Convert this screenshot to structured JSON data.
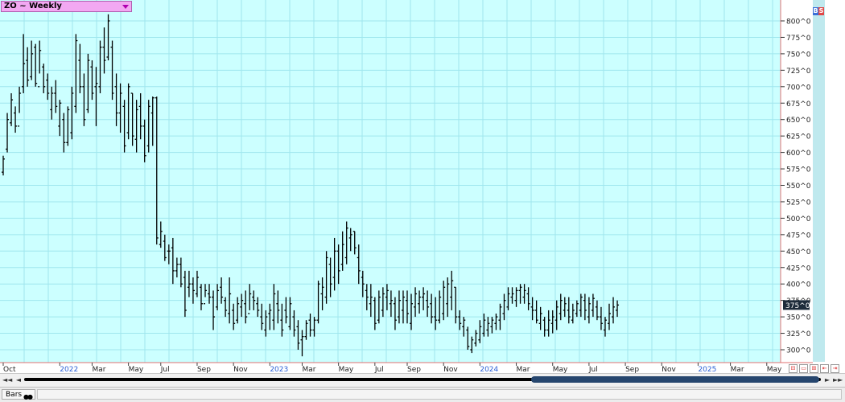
{
  "symbol_label": "ZO ~ Weekly",
  "signals": {
    "buy": "B",
    "sell": "S"
  },
  "bottom_tab_label": "Bars",
  "last_price_label": "375^0",
  "colors": {
    "plot_bg": "#ccffff",
    "grid": "#9fe6ee",
    "axis_line": "#e07070",
    "bars": "#000000",
    "year_label": "#2a5fd6",
    "price_badge_bg": "#1d2b3a"
  },
  "chart_data": {
    "type": "ohlc",
    "title": "ZO ~ Weekly",
    "y_unit_format": "^0 (cents per bushel)",
    "ylim": [
      280,
      820
    ],
    "y_ticks": [
      800,
      775,
      750,
      725,
      700,
      675,
      650,
      625,
      600,
      575,
      550,
      525,
      500,
      475,
      450,
      425,
      400,
      375,
      350,
      325,
      300
    ],
    "y_tick_labels": [
      "800^0",
      "775^0",
      "750^0",
      "725^0",
      "700^0",
      "675^0",
      "650^0",
      "625^0",
      "600^0",
      "575^0",
      "550^0",
      "525^0",
      "500^0",
      "475^0",
      "450^0",
      "425^0",
      "400^0",
      "375^0",
      "350^0",
      "325^0",
      "300^0"
    ],
    "x_labels": [
      {
        "text": "Oct",
        "week": 0,
        "year": false
      },
      {
        "text": "2022",
        "week": 14,
        "year": true
      },
      {
        "text": "Mar",
        "week": 22,
        "year": false
      },
      {
        "text": "May",
        "week": 31,
        "year": false
      },
      {
        "text": "Jul",
        "week": 39,
        "year": false
      },
      {
        "text": "Sep",
        "week": 48,
        "year": false
      },
      {
        "text": "Nov",
        "week": 57,
        "year": false
      },
      {
        "text": "2023",
        "week": 66,
        "year": true
      },
      {
        "text": "Mar",
        "week": 74,
        "year": false
      },
      {
        "text": "May",
        "week": 83,
        "year": false
      },
      {
        "text": "Jul",
        "week": 92,
        "year": false
      },
      {
        "text": "Sep",
        "week": 100,
        "year": false
      },
      {
        "text": "Nov",
        "week": 109,
        "year": false
      },
      {
        "text": "2024",
        "week": 118,
        "year": true
      },
      {
        "text": "Mar",
        "week": 127,
        "year": false
      },
      {
        "text": "May",
        "week": 136,
        "year": false
      },
      {
        "text": "Jul",
        "week": 145,
        "year": false
      },
      {
        "text": "Sep",
        "week": 154,
        "year": false
      },
      {
        "text": "Nov",
        "week": 163,
        "year": false
      },
      {
        "text": "2025",
        "week": 172,
        "year": true
      },
      {
        "text": "Mar",
        "week": 180,
        "year": false
      },
      {
        "text": "May",
        "week": 189,
        "year": false
      }
    ],
    "bars": [
      [
        565,
        595,
        570,
        590
      ],
      [
        600,
        660,
        605,
        650
      ],
      [
        640,
        690,
        645,
        680
      ],
      [
        630,
        670,
        660,
        640
      ],
      [
        660,
        700,
        640,
        690
      ],
      [
        690,
        780,
        700,
        735
      ],
      [
        700,
        760,
        740,
        710
      ],
      [
        710,
        770,
        715,
        750
      ],
      [
        700,
        765,
        760,
        705
      ],
      [
        720,
        770,
        700,
        755
      ],
      [
        690,
        735,
        730,
        700
      ],
      [
        680,
        720,
        710,
        690
      ],
      [
        650,
        700,
        665,
        690
      ],
      [
        660,
        710,
        690,
        670
      ],
      [
        625,
        680,
        640,
        675
      ],
      [
        600,
        660,
        650,
        615
      ],
      [
        610,
        670,
        615,
        665
      ],
      [
        620,
        700,
        630,
        690
      ],
      [
        660,
        780,
        670,
        770
      ],
      [
        690,
        765,
        740,
        700
      ],
      [
        640,
        720,
        700,
        650
      ],
      [
        660,
        750,
        665,
        740
      ],
      [
        680,
        740,
        730,
        690
      ],
      [
        640,
        730,
        700,
        705
      ],
      [
        690,
        770,
        700,
        760
      ],
      [
        720,
        790,
        760,
        740
      ],
      [
        740,
        810,
        745,
        800
      ],
      [
        680,
        770,
        760,
        690
      ],
      [
        640,
        720,
        700,
        660
      ],
      [
        630,
        705,
        660,
        690
      ],
      [
        600,
        680,
        670,
        610
      ],
      [
        620,
        705,
        630,
        700
      ],
      [
        610,
        690,
        690,
        625
      ],
      [
        600,
        680,
        620,
        665
      ],
      [
        620,
        690,
        670,
        640
      ],
      [
        585,
        650,
        640,
        595
      ],
      [
        600,
        680,
        610,
        670
      ],
      [
        610,
        685,
        660,
        683
      ],
      [
        460,
        685,
        683,
        470
      ],
      [
        455,
        495,
        460,
        480
      ],
      [
        435,
        475,
        465,
        440
      ],
      [
        430,
        460,
        450,
        450
      ],
      [
        400,
        470,
        455,
        420
      ],
      [
        410,
        440,
        420,
        430
      ],
      [
        395,
        440,
        430,
        400
      ],
      [
        350,
        420,
        410,
        360
      ],
      [
        380,
        420,
        395,
        400
      ],
      [
        370,
        410,
        400,
        390
      ],
      [
        380,
        420,
        385,
        410
      ],
      [
        360,
        400,
        395,
        370
      ],
      [
        380,
        400,
        370,
        390
      ],
      [
        370,
        400,
        385,
        380
      ],
      [
        330,
        390,
        380,
        350
      ],
      [
        360,
        400,
        365,
        390
      ],
      [
        370,
        410,
        395,
        380
      ],
      [
        350,
        380,
        375,
        360
      ],
      [
        340,
        410,
        355,
        385
      ],
      [
        330,
        370,
        360,
        340
      ],
      [
        340,
        380,
        345,
        370
      ],
      [
        350,
        385,
        365,
        375
      ],
      [
        340,
        390,
        370,
        350
      ],
      [
        360,
        400,
        355,
        385
      ],
      [
        360,
        390,
        380,
        375
      ],
      [
        350,
        380,
        370,
        360
      ],
      [
        330,
        370,
        350,
        340
      ],
      [
        320,
        360,
        330,
        350
      ],
      [
        330,
        370,
        355,
        360
      ],
      [
        330,
        400,
        345,
        385
      ],
      [
        340,
        390,
        370,
        360
      ],
      [
        320,
        370,
        345,
        330
      ],
      [
        340,
        380,
        360,
        350
      ],
      [
        330,
        380,
        335,
        370
      ],
      [
        320,
        360,
        350,
        330
      ],
      [
        300,
        345,
        335,
        310
      ],
      [
        290,
        330,
        315,
        320
      ],
      [
        315,
        345,
        320,
        340
      ],
      [
        320,
        355,
        345,
        330
      ],
      [
        320,
        350,
        330,
        345
      ],
      [
        340,
        405,
        345,
        400
      ],
      [
        360,
        410,
        385,
        395
      ],
      [
        370,
        450,
        380,
        440
      ],
      [
        380,
        440,
        430,
        400
      ],
      [
        390,
        470,
        410,
        450
      ],
      [
        400,
        460,
        450,
        420
      ],
      [
        420,
        480,
        430,
        460
      ],
      [
        430,
        495,
        440,
        485
      ],
      [
        450,
        485,
        470,
        475
      ],
      [
        445,
        480,
        480,
        455
      ],
      [
        400,
        460,
        440,
        420
      ],
      [
        380,
        420,
        410,
        400
      ],
      [
        360,
        400,
        390,
        380
      ],
      [
        350,
        400,
        370,
        380
      ],
      [
        330,
        380,
        375,
        340
      ],
      [
        340,
        390,
        345,
        380
      ],
      [
        350,
        395,
        360,
        385
      ],
      [
        360,
        400,
        380,
        390
      ],
      [
        350,
        390,
        370,
        375
      ],
      [
        330,
        380,
        370,
        345
      ],
      [
        340,
        390,
        350,
        375
      ],
      [
        340,
        390,
        360,
        380
      ],
      [
        340,
        390,
        375,
        355
      ],
      [
        330,
        385,
        340,
        370
      ],
      [
        350,
        395,
        365,
        385
      ],
      [
        355,
        390,
        370,
        380
      ],
      [
        360,
        395,
        380,
        385
      ],
      [
        350,
        390,
        375,
        365
      ],
      [
        340,
        385,
        370,
        350
      ],
      [
        330,
        380,
        350,
        345
      ],
      [
        340,
        390,
        345,
        380
      ],
      [
        345,
        405,
        355,
        395
      ],
      [
        350,
        410,
        370,
        400
      ],
      [
        360,
        420,
        380,
        405
      ],
      [
        340,
        395,
        395,
        350
      ],
      [
        330,
        360,
        350,
        340
      ],
      [
        320,
        350,
        335,
        345
      ],
      [
        300,
        335,
        330,
        305
      ],
      [
        295,
        320,
        300,
        315
      ],
      [
        305,
        330,
        310,
        325
      ],
      [
        310,
        345,
        315,
        335
      ],
      [
        320,
        355,
        325,
        345
      ],
      [
        320,
        350,
        330,
        340
      ],
      [
        325,
        350,
        335,
        345
      ],
      [
        330,
        355,
        340,
        350
      ],
      [
        330,
        370,
        345,
        365
      ],
      [
        345,
        385,
        355,
        375
      ],
      [
        360,
        395,
        365,
        385
      ],
      [
        370,
        395,
        380,
        385
      ],
      [
        365,
        395,
        375,
        390
      ],
      [
        370,
        400,
        390,
        395
      ],
      [
        370,
        400,
        380,
        390
      ],
      [
        360,
        395,
        385,
        370
      ],
      [
        345,
        380,
        365,
        360
      ],
      [
        340,
        375,
        360,
        345
      ],
      [
        330,
        365,
        340,
        355
      ],
      [
        320,
        350,
        345,
        330
      ],
      [
        320,
        360,
        330,
        345
      ],
      [
        325,
        360,
        340,
        350
      ],
      [
        330,
        375,
        345,
        365
      ],
      [
        345,
        385,
        355,
        375
      ],
      [
        350,
        380,
        360,
        370
      ],
      [
        340,
        380,
        360,
        350
      ],
      [
        340,
        370,
        345,
        360
      ],
      [
        350,
        375,
        355,
        370
      ],
      [
        350,
        385,
        360,
        380
      ],
      [
        345,
        385,
        375,
        360
      ],
      [
        340,
        380,
        350,
        370
      ],
      [
        350,
        385,
        360,
        378
      ],
      [
        345,
        375,
        365,
        350
      ],
      [
        330,
        365,
        350,
        340
      ],
      [
        320,
        350,
        330,
        345
      ],
      [
        330,
        370,
        340,
        355
      ],
      [
        340,
        380,
        350,
        365
      ],
      [
        350,
        375,
        360,
        368
      ]
    ]
  }
}
